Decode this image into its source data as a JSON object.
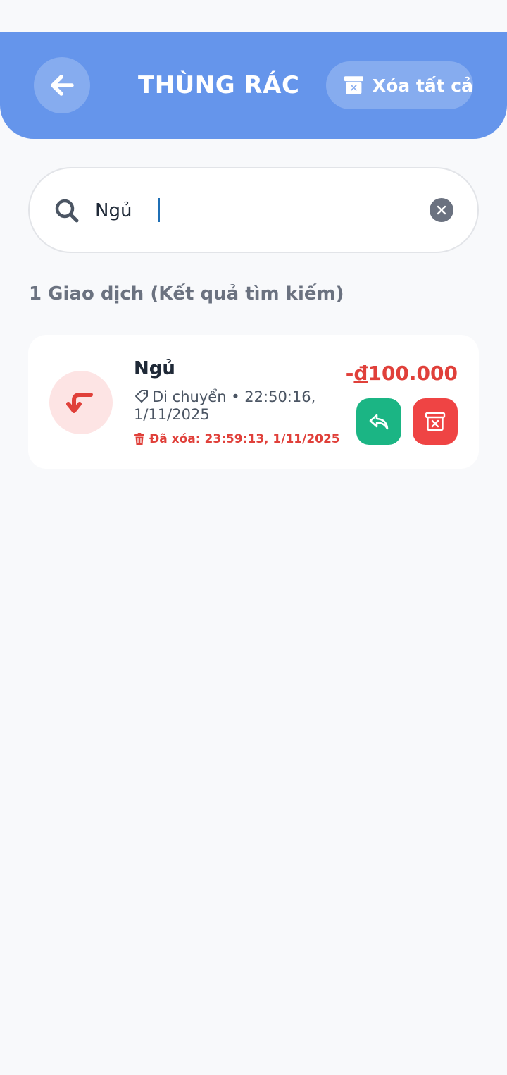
{
  "header": {
    "title": "THÙNG RÁC",
    "clear_all_label": "Xóa tất cả",
    "colors": {
      "background": "#6595eb",
      "text": "#ffffff"
    }
  },
  "search": {
    "value": "Ngủ",
    "placeholder": ""
  },
  "results": {
    "count_label": "1 Giao dịch (Kết quả tìm kiếm)"
  },
  "transactions": [
    {
      "name": "Ngủ",
      "category": "Di chuyển",
      "separator": "•",
      "datetime": "22:50:16, 1/11/2025",
      "deleted_label": "Đã xóa: 23:59:13, 1/11/2025",
      "amount_sign": "-",
      "currency": "đ",
      "amount": "100.000",
      "icon": "return-arrow-icon",
      "colors": {
        "amount": "#e0403a",
        "restore": "#1bb584",
        "delete": "#ef4444"
      }
    }
  ]
}
